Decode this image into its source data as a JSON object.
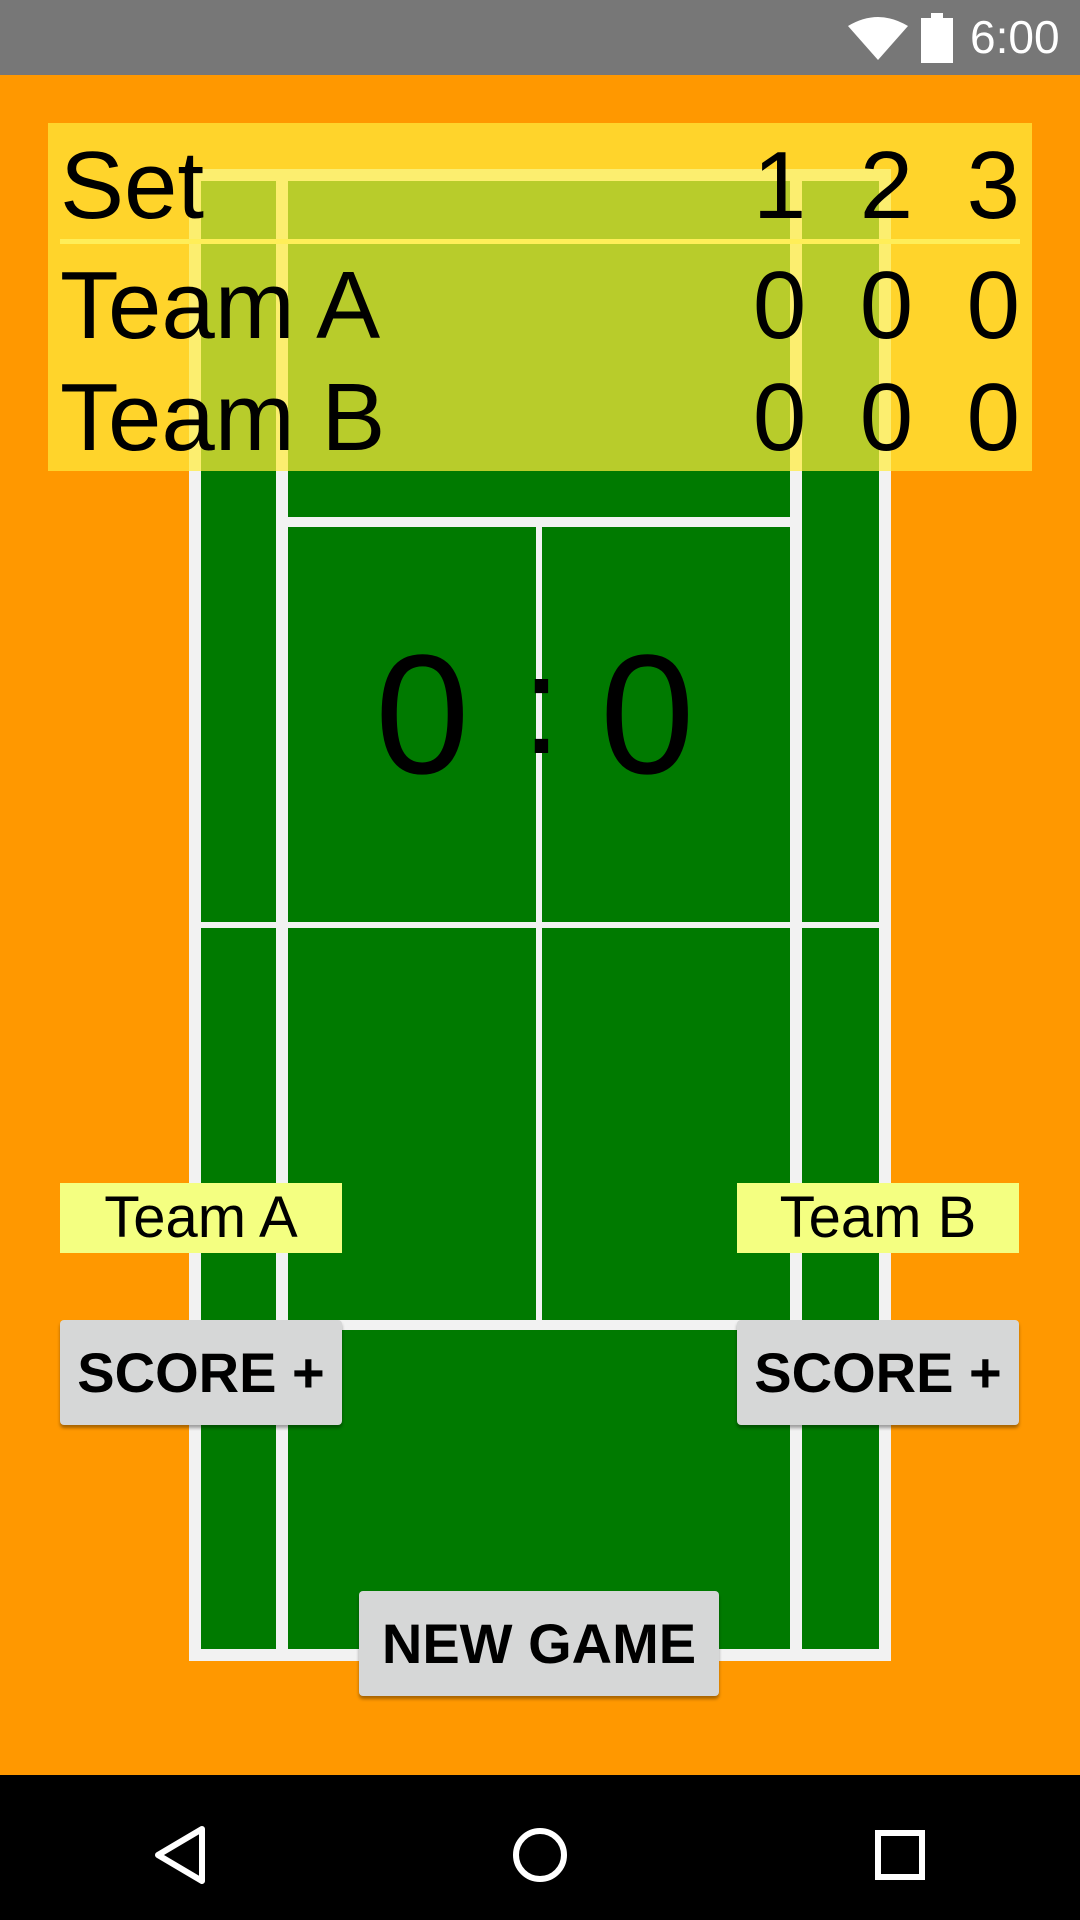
{
  "status_bar": {
    "time": "6:00",
    "icons": [
      "wifi-icon",
      "battery-icon"
    ]
  },
  "colors": {
    "background": "#FF9800",
    "court": "#007A00",
    "lines": "#FFFFFF",
    "scoreboard": "#FFEB3B",
    "team_label": "#F4FF81",
    "button": "#D6D7D7"
  },
  "scoreboard": {
    "header": {
      "label": "Set",
      "columns": [
        "1",
        "2",
        "3"
      ]
    },
    "rows": [
      {
        "team": "Team A",
        "sets": [
          "0",
          "0",
          "0"
        ]
      },
      {
        "team": "Team B",
        "sets": [
          "0",
          "0",
          "0"
        ]
      }
    ]
  },
  "game_score": {
    "team_a": "0",
    "separator": ":",
    "team_b": "0"
  },
  "team_a": {
    "label": "Team A",
    "button": "SCORE +"
  },
  "team_b": {
    "label": "Team B",
    "button": "SCORE +"
  },
  "new_game_button": "NEW GAME",
  "nav_bar": {
    "icons": [
      "back-icon",
      "home-icon",
      "recents-icon"
    ]
  }
}
